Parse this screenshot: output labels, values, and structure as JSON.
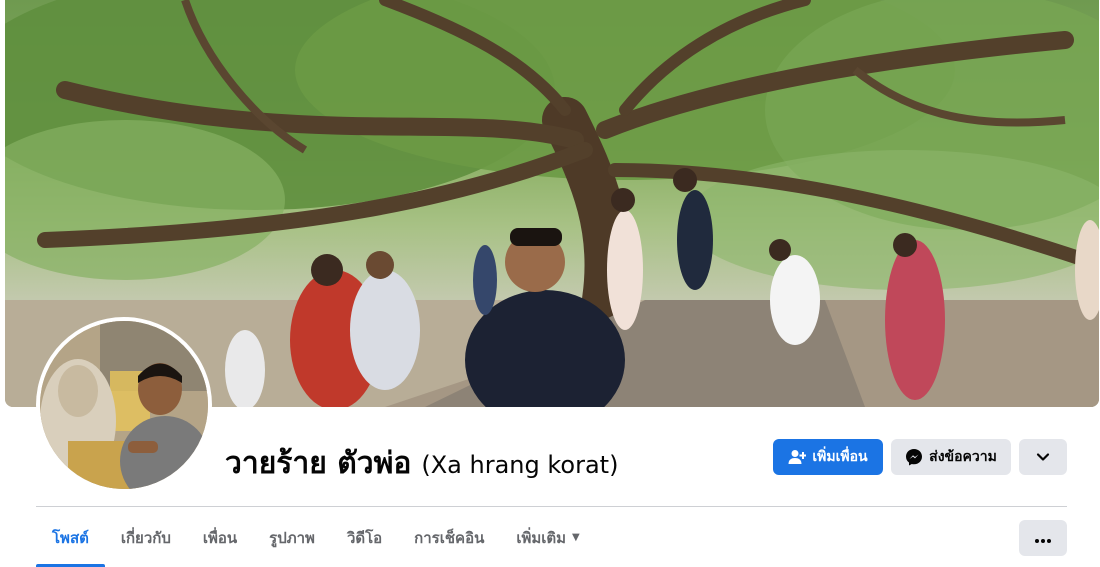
{
  "profile": {
    "name": "วายร้าย ตัวพ่อ",
    "alternate_name": "(Xa hrang korat)"
  },
  "actions": {
    "add_friend_label": "เพิ่มเพื่อน",
    "message_label": "ส่งข้อความ"
  },
  "tabs": [
    {
      "label": "โพสต์",
      "active": true
    },
    {
      "label": "เกี่ยวกับ",
      "active": false
    },
    {
      "label": "เพื่อน",
      "active": false
    },
    {
      "label": "รูปภาพ",
      "active": false
    },
    {
      "label": "วิดีโอ",
      "active": false
    },
    {
      "label": "การเช็คอิน",
      "active": false
    },
    {
      "label": "เพิ่มเติม",
      "active": false
    }
  ],
  "icons": {
    "add_friend": "person-plus-icon",
    "message": "messenger-icon",
    "dropdown": "chevron-down-icon",
    "more_tabs": "caret-down-icon",
    "overflow": "more-dots-icon"
  },
  "colors": {
    "accent": "#1b74e4",
    "secondary_button": "#e4e6eb",
    "text_primary": "#050505",
    "text_secondary": "#65676b"
  }
}
